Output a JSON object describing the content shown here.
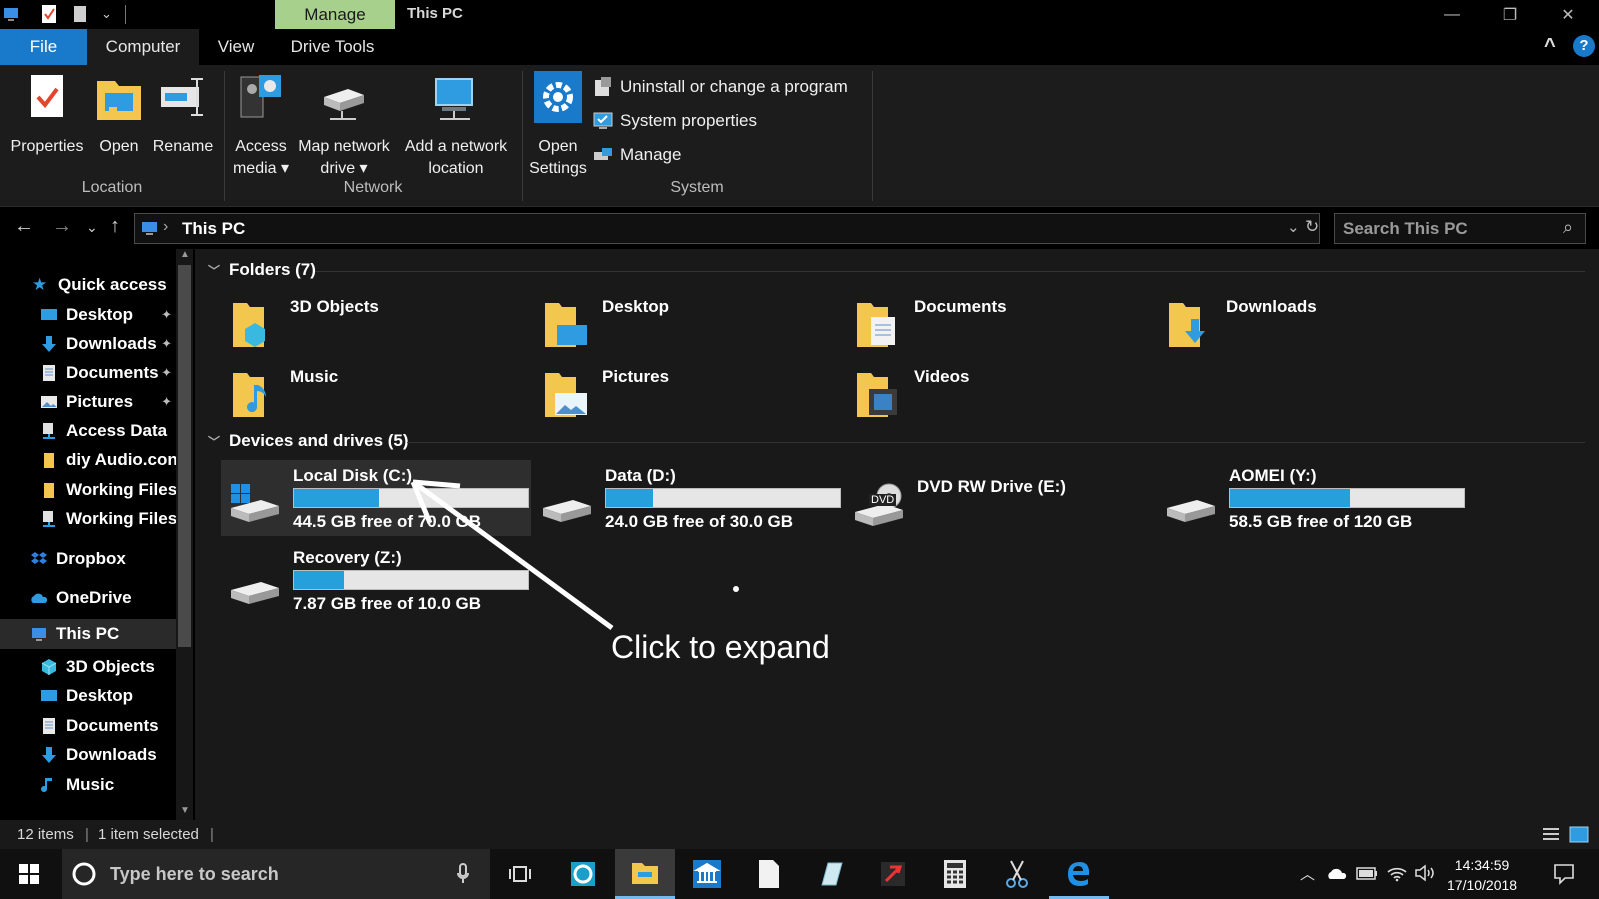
{
  "titlebar": {
    "context_tab": "Manage",
    "title": "This PC",
    "minimize": "—",
    "restore": "❐",
    "close": "✕"
  },
  "tabs": {
    "file": "File",
    "computer": "Computer",
    "view": "View",
    "drive_tools": "Drive Tools",
    "collapse": "^",
    "help": "?"
  },
  "ribbon": {
    "location": {
      "label": "Location",
      "properties": "Properties",
      "open": "Open",
      "rename": "Rename"
    },
    "network": {
      "label": "Network",
      "access_media_1": "Access",
      "access_media_2": "media ▾",
      "map_drive_1": "Map network",
      "map_drive_2": "drive ▾",
      "add_location_1": "Add a network",
      "add_location_2": "location"
    },
    "system": {
      "label": "System",
      "open_settings_1": "Open",
      "open_settings_2": "Settings",
      "uninstall": "Uninstall or change a program",
      "system_properties": "System properties",
      "manage": "Manage"
    }
  },
  "nav": {
    "back": "←",
    "forward": "→",
    "recent": "⌄",
    "up": "↑",
    "crumb_sep": "›",
    "address": "This PC",
    "address_dropdown": "⌄",
    "refresh": "↻",
    "search_placeholder": "Search This PC",
    "search_icon": "⌕"
  },
  "sidebar": {
    "quick_access": "Quick access",
    "pin": "📌",
    "items": [
      {
        "label": "Desktop"
      },
      {
        "label": "Downloads"
      },
      {
        "label": "Documents"
      },
      {
        "label": "Pictures"
      },
      {
        "label": "Access Data"
      },
      {
        "label": "diy Audio.con"
      },
      {
        "label": "Working Files"
      },
      {
        "label": "Working Files"
      }
    ],
    "dropbox": "Dropbox",
    "onedrive": "OneDrive",
    "this_pc": "This PC",
    "pc_items": [
      {
        "label": "3D Objects"
      },
      {
        "label": "Desktop"
      },
      {
        "label": "Documents"
      },
      {
        "label": "Downloads"
      },
      {
        "label": "Music"
      }
    ]
  },
  "content": {
    "folders_header": "Folders (7)",
    "folders": [
      {
        "name": "3D Objects"
      },
      {
        "name": "Desktop"
      },
      {
        "name": "Documents"
      },
      {
        "name": "Downloads"
      },
      {
        "name": "Music"
      },
      {
        "name": "Pictures"
      },
      {
        "name": "Videos"
      }
    ],
    "drives_header": "Devices and drives (5)",
    "drives": [
      {
        "name": "Local Disk (C:)",
        "free": "44.5 GB free of 70.0 GB",
        "used_fraction": 0.364
      },
      {
        "name": "Data (D:)",
        "free": "24.0 GB free of 30.0 GB",
        "used_fraction": 0.2
      },
      {
        "name": "DVD RW Drive (E:)"
      },
      {
        "name": "AOMEI (Y:)",
        "free": "58.5 GB free of 120 GB",
        "used_fraction": 0.5125
      },
      {
        "name": "Recovery (Z:)",
        "free": "7.87 GB free of 10.0 GB",
        "used_fraction": 0.213
      }
    ],
    "dvd_label": "DVD",
    "annotation": "Click to expand"
  },
  "status": {
    "items": "12 items",
    "selected": "1 item selected"
  },
  "taskbar": {
    "search_placeholder": "Type here to search",
    "time": "14:34:59",
    "date": "17/10/2018"
  },
  "colors": {
    "accent": "#1979ca",
    "context_tab": "#a7d08c",
    "drive_bar": "#26a0da",
    "folder": "#f3c74d"
  }
}
